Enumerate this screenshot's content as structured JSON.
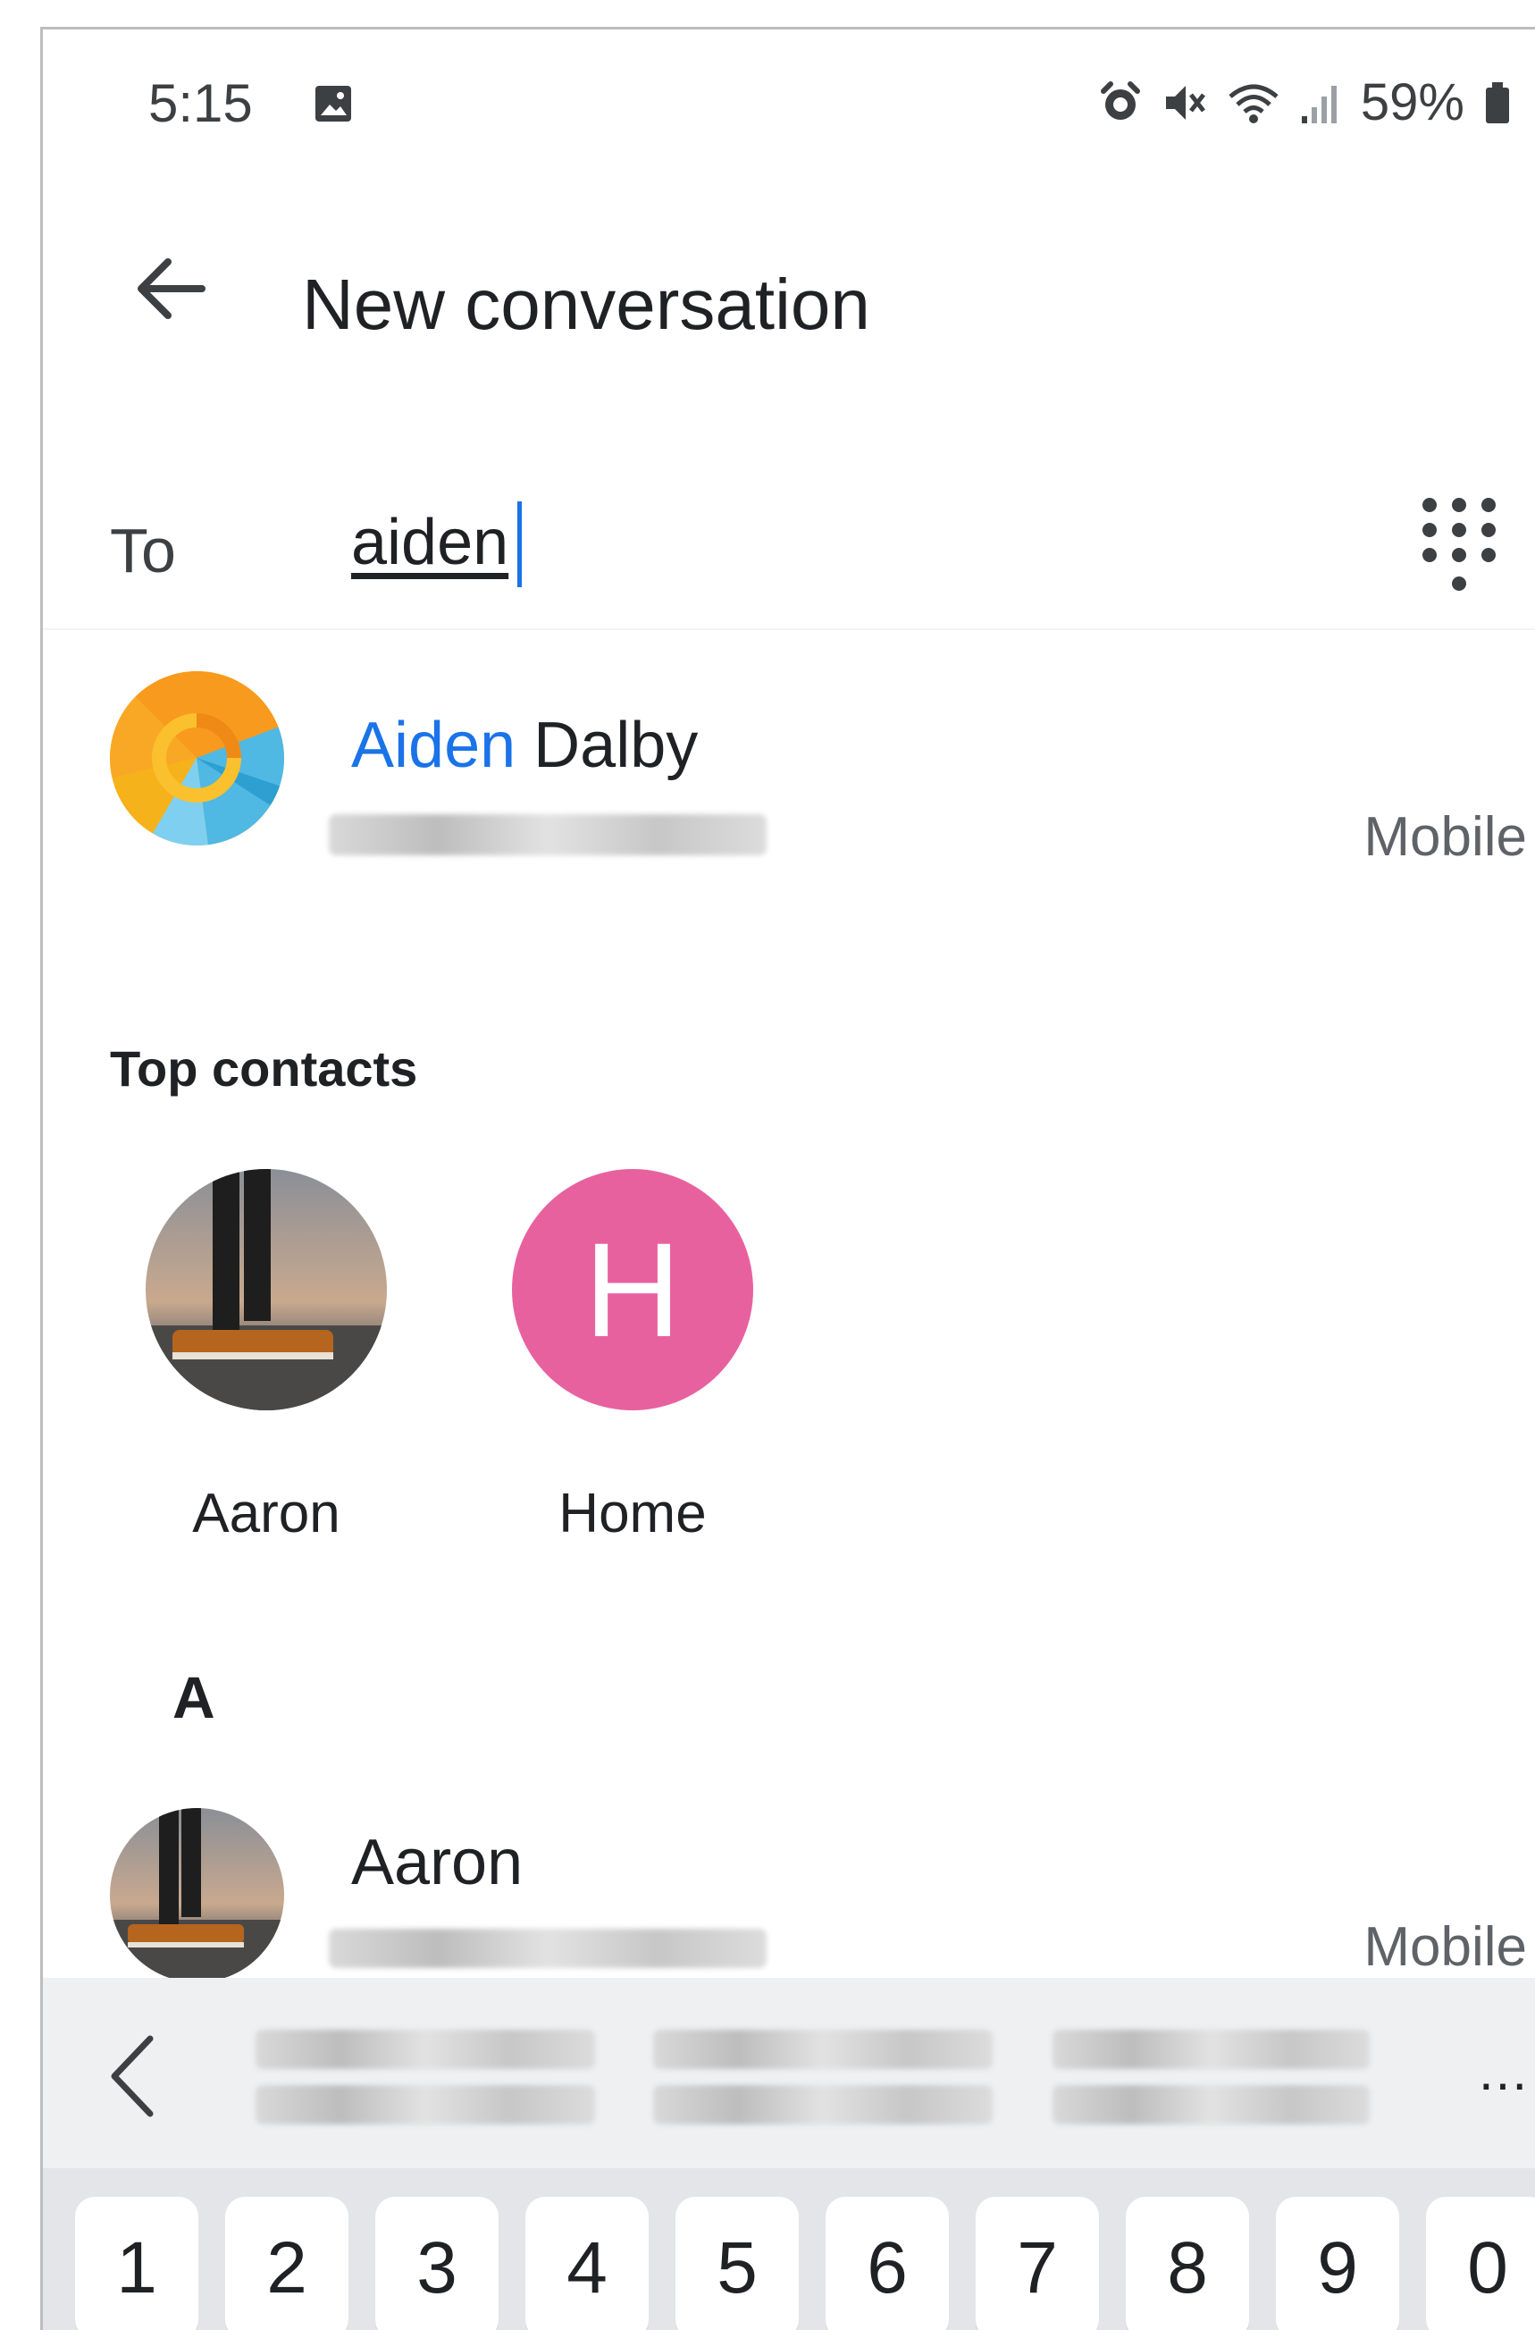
{
  "status_bar": {
    "time": "5:15",
    "battery_percent": "59%",
    "icons": [
      "image-icon",
      "alarm-icon",
      "mute-icon",
      "wifi-icon",
      "signal-icon",
      "battery-icon"
    ]
  },
  "app_bar": {
    "title": "New conversation",
    "back_icon": "arrow-left-icon"
  },
  "to_field": {
    "label": "To",
    "value": "aiden",
    "dialpad_icon": "dialpad-icon"
  },
  "search_result": {
    "name_highlight": "Aiden",
    "name_rest": " Dalby",
    "type": "Mobile",
    "highlight_color": "#1a73e8"
  },
  "top_contacts": {
    "title": "Top contacts",
    "items": [
      {
        "name": "Aaron"
      },
      {
        "name": "Home",
        "initial": "H",
        "color": "#e8619f"
      }
    ]
  },
  "contacts_section": {
    "letter": "A",
    "items": [
      {
        "name": "Aaron",
        "type": "Mobile"
      }
    ]
  },
  "suggestion_bar": {
    "back_icon": "chevron-left-icon",
    "more_label": "..."
  },
  "keyboard": {
    "keys": [
      "1",
      "2",
      "3",
      "4",
      "5",
      "6",
      "7",
      "8",
      "9",
      "0"
    ]
  }
}
